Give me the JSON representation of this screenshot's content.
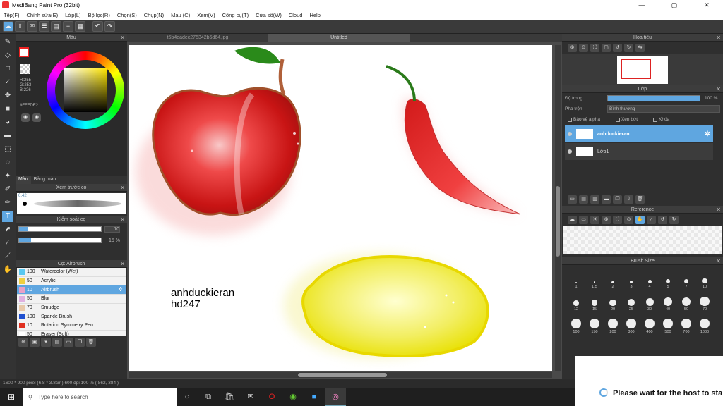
{
  "window": {
    "title": "MediBang Paint Pro (32bit)",
    "controls": [
      "—",
      "▢",
      "✕"
    ]
  },
  "menu": [
    "Tệp(F)",
    "Chỉnh sửa(E)",
    "Lớp(L)",
    "Bộ lọc(R)",
    "Chọn(S)",
    "Chụp(N)",
    "Màu (C)",
    "Xem(V)",
    "Công cụ(T)",
    "Cửa sổ(W)",
    "Cloud",
    "Help"
  ],
  "color_panel": {
    "title": "Màu",
    "rgb": "R:255\nG:253\nB:226",
    "hex": "#FFFDE2",
    "tabs": [
      "Màu",
      "Bảng màu"
    ]
  },
  "brush_preview": {
    "title": "Xem trước cọ",
    "size_label": "0.42"
  },
  "brush_control": {
    "title": "Kiểm soát cọ",
    "size_value": "10",
    "opacity_value": "15 %",
    "size_fraction": 0.1,
    "opacity_fraction": 0.15
  },
  "brush_panel": {
    "title": "Cọ: Airbrush",
    "items": [
      {
        "size": "100",
        "name": "Watercolor (Wet)",
        "color": "#5ac8f0"
      },
      {
        "size": "50",
        "name": "Acrylic",
        "color": "#f0d040"
      },
      {
        "size": "10",
        "name": "Airbrush",
        "color": "#e8a0c8",
        "selected": true
      },
      {
        "size": "50",
        "name": "Blur",
        "color": "#e0b0e0"
      },
      {
        "size": "70",
        "name": "Smudge",
        "color": "#e8c8a8"
      },
      {
        "size": "100",
        "name": "Sparkle Brush",
        "color": "#2050d0"
      },
      {
        "size": "10",
        "name": "Rotation Symmetry Pen",
        "color": "#e03020"
      },
      {
        "size": "50",
        "name": "Eraser (Soft)",
        "color": "#ffffff"
      }
    ]
  },
  "document_tabs": [
    "t6b4eadec275342b6d64.jpg",
    "Untitled"
  ],
  "canvas": {
    "signature_line1": "anhduckieran",
    "signature_line2": "hd247"
  },
  "navigator": {
    "title": "Hoa tiêu"
  },
  "layer_panel": {
    "title": "Lớp",
    "opacity_label": "Độ trong",
    "opacity_value": "100 %",
    "blend_label": "Pha trộn",
    "blend_value": "Bình thường",
    "alpha_label": "Bảo vệ alpha",
    "clip_label": "Xén bớt",
    "lock_label": "Khóa",
    "layers": [
      {
        "name": "anhduckieran",
        "selected": true
      },
      {
        "name": "Lớp1",
        "selected": false
      }
    ]
  },
  "reference": {
    "title": "Reference"
  },
  "brush_size": {
    "title": "Brush Size",
    "sizes": [
      "1",
      "1.5",
      "2",
      "3",
      "4",
      "5",
      "7",
      "10",
      "12",
      "15",
      "20",
      "25",
      "30",
      "40",
      "50",
      "70",
      "100",
      "150",
      "200",
      "300",
      "400",
      "500",
      "700",
      "1000"
    ]
  },
  "status": {
    "text": "1600 * 900 pixel   (6.8 * 3.8cm)   600 dpi   100 %   ( 862, 384 )"
  },
  "taskbar": {
    "search_placeholder": "Type here to search"
  },
  "notice": {
    "message": "Please wait for the host to sta"
  }
}
